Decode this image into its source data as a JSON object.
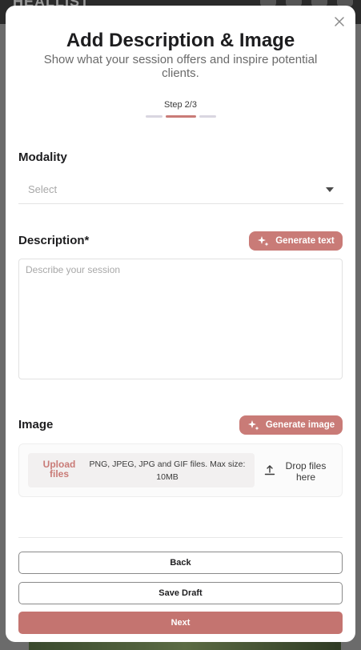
{
  "background": {
    "app_name": "HEALLIST"
  },
  "modal": {
    "title": "Add Description & Image",
    "subtitle": "Show what your session offers and inspire potential clients.",
    "step_label": "Step 2/3",
    "steps_total": 3,
    "current_step": 2
  },
  "modality": {
    "label": "Modality",
    "selected": "Select"
  },
  "description": {
    "label": "Description*",
    "generate_label": "Generate text",
    "placeholder": "Describe your session",
    "value": ""
  },
  "image": {
    "label": "Image",
    "generate_label": "Generate image",
    "upload_link": "Upload files",
    "upload_hint": "PNG, JPEG, JPG and GIF files. Max size: 10MB",
    "drop_text": "Drop files here"
  },
  "footer": {
    "back_label": "Back",
    "save_draft_label": "Save Draft",
    "next_label": "Next"
  },
  "colors": {
    "accent": "#c97b77",
    "primary_button": "#c47470",
    "step_inactive": "#d9d6e0"
  },
  "icons": {
    "close": "close-icon",
    "select_caret": "caret-down-icon",
    "generate": "sparkles-icon",
    "upload": "upload-icon"
  }
}
